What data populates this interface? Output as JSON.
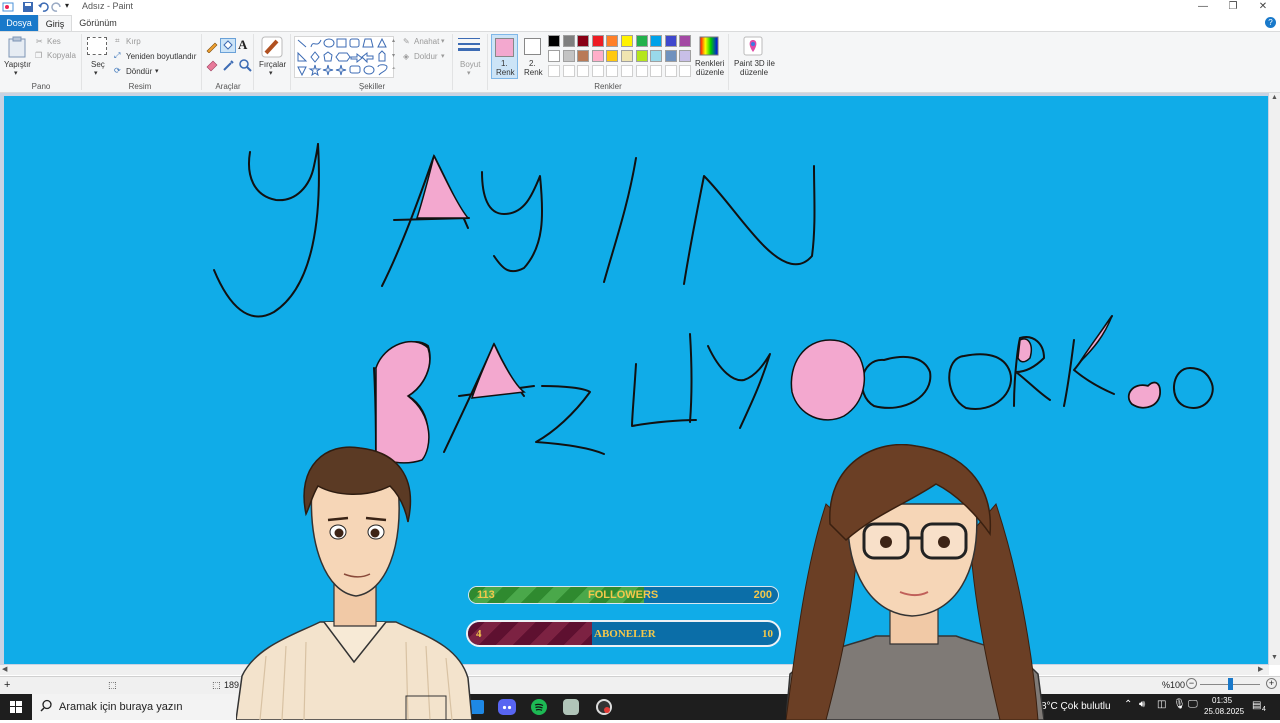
{
  "window": {
    "title": "Adsız - Paint"
  },
  "tabs": {
    "file": "Dosya",
    "home": "Giriş",
    "view": "Görünüm"
  },
  "ribbon": {
    "clipboard": {
      "paste": "Yapıştır",
      "cut": "Kes",
      "copy": "Kopyala",
      "group": "Pano"
    },
    "image": {
      "select": "Seç",
      "crop": "Kırp",
      "resize": "Yeniden boyutlandır",
      "rotate": "Döndür",
      "group": "Resim"
    },
    "tools": {
      "group": "Araçlar"
    },
    "brushes": {
      "label": "Fırçalar"
    },
    "shapes": {
      "outline": "Anahat",
      "fill": "Doldur",
      "group": "Şekiller"
    },
    "size": {
      "label": "Boyut"
    },
    "colors": {
      "color1_line1": "1.",
      "color1_line2": "Renk",
      "color2_line1": "2.",
      "color2_line2": "Renk",
      "edit_line1": "Renkleri",
      "edit_line2": "düzenle",
      "group": "Renkler",
      "color1_value": "#f3a8cf",
      "row1": [
        "#000000",
        "#7f7f7f",
        "#880015",
        "#ed1c24",
        "#ff7f27",
        "#fff200",
        "#22b14c",
        "#00a2e8",
        "#3f48cc",
        "#a349a4"
      ],
      "row2": [
        "#ffffff",
        "#c3c3c3",
        "#b97a57",
        "#ffaec9",
        "#ffc90e",
        "#efe4b0",
        "#b5e61d",
        "#99d9ea",
        "#7092be",
        "#c8bfe7"
      ]
    },
    "paint3d": {
      "line1": "Paint 3D ile",
      "line2": "düzenle"
    }
  },
  "canvas": {
    "background": "#10ace8"
  },
  "overlay": {
    "followers": {
      "current": "113",
      "label": "FOLLOWERS",
      "goal": "200",
      "progress": 0.565
    },
    "subscribers": {
      "current": "4",
      "label": "ABONELER",
      "goal": "10",
      "progress": 0.4
    }
  },
  "statusbar": {
    "size": "189",
    "zoom": "%100"
  },
  "taskbar": {
    "search_placeholder": "Aramak için buraya yazın",
    "weather": "8°C  Çok bulutlu",
    "time": "01:35",
    "date": "25.08.2025",
    "notifications": "4"
  }
}
